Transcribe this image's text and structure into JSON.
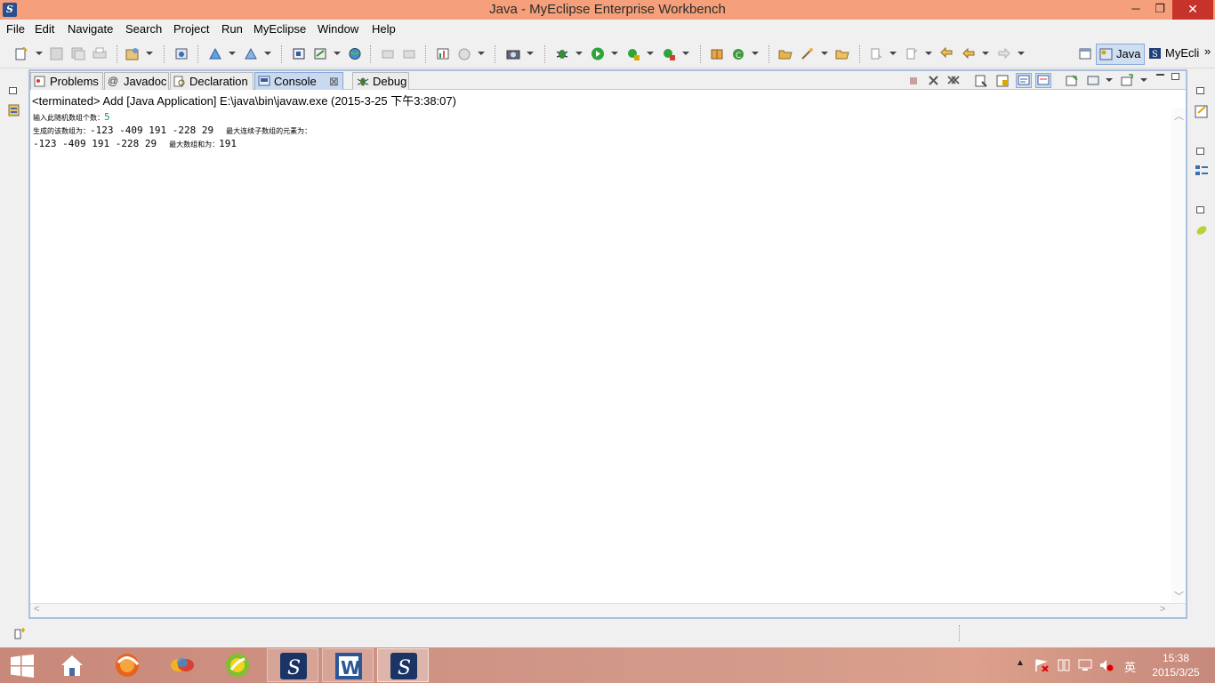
{
  "window": {
    "title": "Java - MyEclipse Enterprise Workbench",
    "minimize": "─",
    "maximize": "❐",
    "close": "✕"
  },
  "menu": [
    "File",
    "Edit",
    "Navigate",
    "Search",
    "Project",
    "Run",
    "MyEclipse",
    "Window",
    "Help"
  ],
  "perspectives": {
    "java": "Java",
    "myeclipse": "MyEcli",
    "more": "»"
  },
  "tabs": [
    {
      "label": "Problems",
      "icon": "problems-icon"
    },
    {
      "label": "Javadoc",
      "icon": "javadoc-icon"
    },
    {
      "label": "Declaration",
      "icon": "declaration-icon"
    },
    {
      "label": "Console",
      "icon": "console-icon",
      "active": true,
      "close": "⊠"
    },
    {
      "label": "Debug",
      "icon": "debug-icon"
    }
  ],
  "console": {
    "status": "<terminated> Add [Java Application] E:\\java\\bin\\javaw.exe (2015-3-25 下午3:38:07)",
    "line1_prompt": "输入此随机数组个数：",
    "line1_input": "5",
    "line2_label": "生成的该数组为：",
    "line2_values": "-123  -409  191  -228  29",
    "line2_suffix": "最大连续子数组的元素为：",
    "line3_values": "-123  -409  191  -228  29",
    "line3_label": "最大数组和为：",
    "line3_result": "191"
  },
  "taskbar": {
    "apps": [
      "windows-start",
      "file-explorer",
      "browser-firefox",
      "app-colorful",
      "browser-360",
      "myeclipse",
      "word",
      "myeclipse-active"
    ],
    "tray_lang": "英",
    "time": "15:38",
    "date": "2015/3/25"
  },
  "colors": {
    "titlebar": "#f5a07a",
    "close": "#c7322b",
    "active_tab": "#c9daf0",
    "input_text": "#0ea06f"
  }
}
